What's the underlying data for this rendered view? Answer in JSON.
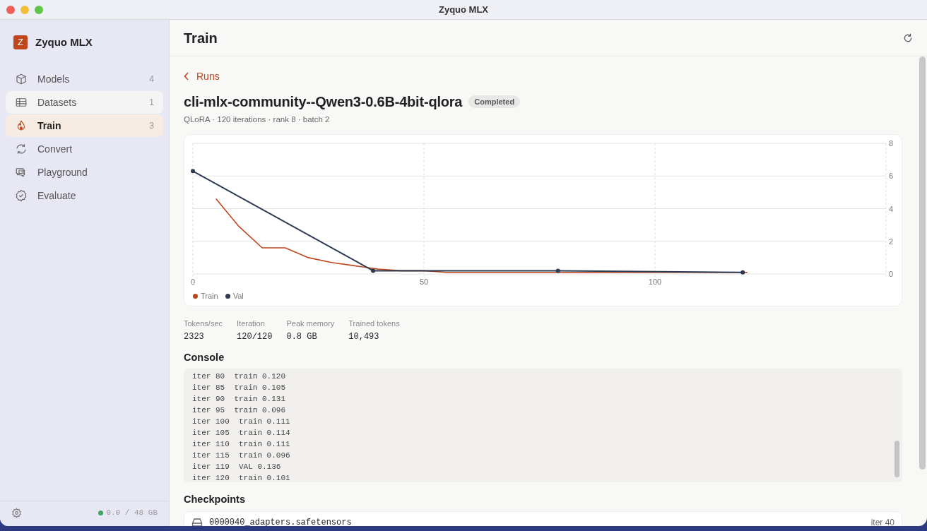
{
  "window": {
    "title": "Zyquo MLX"
  },
  "sidebar": {
    "app_name": "Zyquo MLX",
    "logo_letter": "Z",
    "items": [
      {
        "label": "Models",
        "count": "4",
        "selected": false,
        "hovered": false
      },
      {
        "label": "Datasets",
        "count": "1",
        "selected": false,
        "hovered": true
      },
      {
        "label": "Train",
        "count": "3",
        "selected": true,
        "hovered": false
      },
      {
        "label": "Convert",
        "selected": false,
        "hovered": false
      },
      {
        "label": "Playground",
        "selected": false,
        "hovered": false
      },
      {
        "label": "Evaluate",
        "selected": false,
        "hovered": false
      }
    ],
    "memory": {
      "text": "0.0 / 48 GB",
      "color": "#3fa45e"
    }
  },
  "header": {
    "title": "Train"
  },
  "back_link": "Runs",
  "run": {
    "name": "cli-mlx-community--Qwen3-0.6B-4bit-qlora",
    "status": "Completed",
    "summary": "QLoRA · 120 iterations · rank 8 · batch 2",
    "chart_data": {
      "type": "line",
      "grid": true,
      "xlim": [
        0,
        150
      ],
      "ylim": [
        0,
        8
      ],
      "xticks": [
        0,
        50,
        100
      ],
      "yticks": [
        0,
        2,
        4,
        6,
        8
      ],
      "series": [
        {
          "name": "Train",
          "color": "#c0461c",
          "x": [
            5,
            10,
            15,
            20,
            25,
            30,
            35,
            40,
            45,
            50,
            55,
            60,
            65,
            70,
            75,
            80,
            85,
            90,
            95,
            100,
            105,
            110,
            115,
            120
          ],
          "values": [
            4.6,
            2.9,
            1.6,
            1.6,
            1.0,
            0.7,
            0.5,
            0.3,
            0.2,
            0.2,
            0.1,
            0.1,
            0.1,
            0.1,
            0.1,
            0.1,
            0.1,
            0.1,
            0.1,
            0.1,
            0.1,
            0.1,
            0.1,
            0.1
          ]
        },
        {
          "name": "Val",
          "color": "#2c3a52",
          "marker": true,
          "x": [
            0,
            39,
            79,
            119
          ],
          "values": [
            6.3,
            0.2,
            0.2,
            0.1
          ]
        }
      ]
    },
    "stats": [
      {
        "label": "Tokens/sec",
        "value": "2323"
      },
      {
        "label": "Iteration",
        "value": "120/120"
      },
      {
        "label": "Peak memory",
        "value": "0.8 GB"
      },
      {
        "label": "Trained tokens",
        "value": "10,493"
      }
    ]
  },
  "console": {
    "title": "Console",
    "lines": [
      "iter 80  train 0.120",
      "iter 85  train 0.105",
      "iter 90  train 0.131",
      "iter 95  train 0.096",
      "iter 100  train 0.111",
      "iter 105  train 0.114",
      "iter 110  train 0.111",
      "iter 115  train 0.096",
      "iter 119  VAL 0.136",
      "iter 120  train 0.101"
    ]
  },
  "checkpoints": {
    "title": "Checkpoints",
    "items": [
      {
        "file": "0000040_adapters.safetensors",
        "iteration": "iter 40"
      }
    ]
  }
}
